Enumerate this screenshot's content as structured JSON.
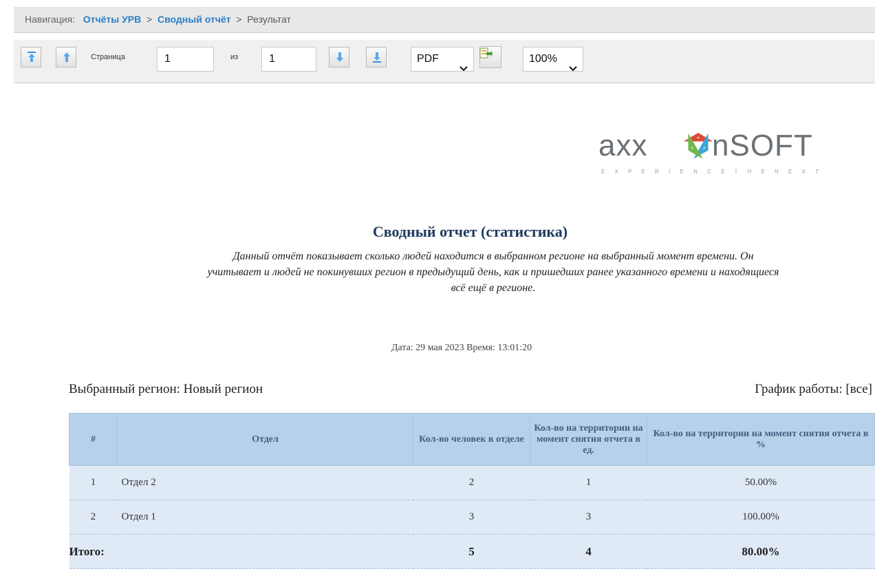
{
  "breadcrumb": {
    "prefix": "Навигация:",
    "items": [
      "Отчёты УРВ",
      "Сводный отчёт"
    ],
    "separator": ">",
    "current": "Результат"
  },
  "toolbar": {
    "page_label": "Страница",
    "page_value": "1",
    "of_label": "из",
    "total_pages": "1",
    "export_format": "PDF",
    "zoom": "100%",
    "icons": [
      "first-page-icon",
      "prev-page-icon",
      "next-page-icon",
      "last-page-icon",
      "export-icon"
    ]
  },
  "report": {
    "logo_text": "axxonsoft",
    "logo_tagline": "EXPERIENCE THE NEXT",
    "title": "Сводный отчет (статистика)",
    "description": "Данный отчёт показывает сколько людей находится в выбранном регионе на выбранный момент времени. Он учитывает и людей не покинувших регион в предыдущий день, как и пришедших ранее указанного времени и находящиеся всё ещё в регионе.",
    "date": "Дата: 29 мая 2023 Время: 13:01:20",
    "region": "Выбранный регион: Новый регион",
    "schedule": "График работы: [все]",
    "table": {
      "headers": [
        "#",
        "Отдел",
        "Кол-во человек в отделе",
        "Кол-во на территории на момент снятия отчета в ед.",
        "Кол-во на территории на момент снятия отчета в %"
      ],
      "rows": [
        {
          "num": "1",
          "dept": "Отдел 2",
          "count": "2",
          "on_site": "1",
          "pct": "50.00%"
        },
        {
          "num": "2",
          "dept": "Отдел 1",
          "count": "3",
          "on_site": "3",
          "pct": "100.00%"
        }
      ],
      "total": {
        "label": "Итого:",
        "count": "5",
        "on_site": "4",
        "pct": "80.00%"
      }
    }
  }
}
